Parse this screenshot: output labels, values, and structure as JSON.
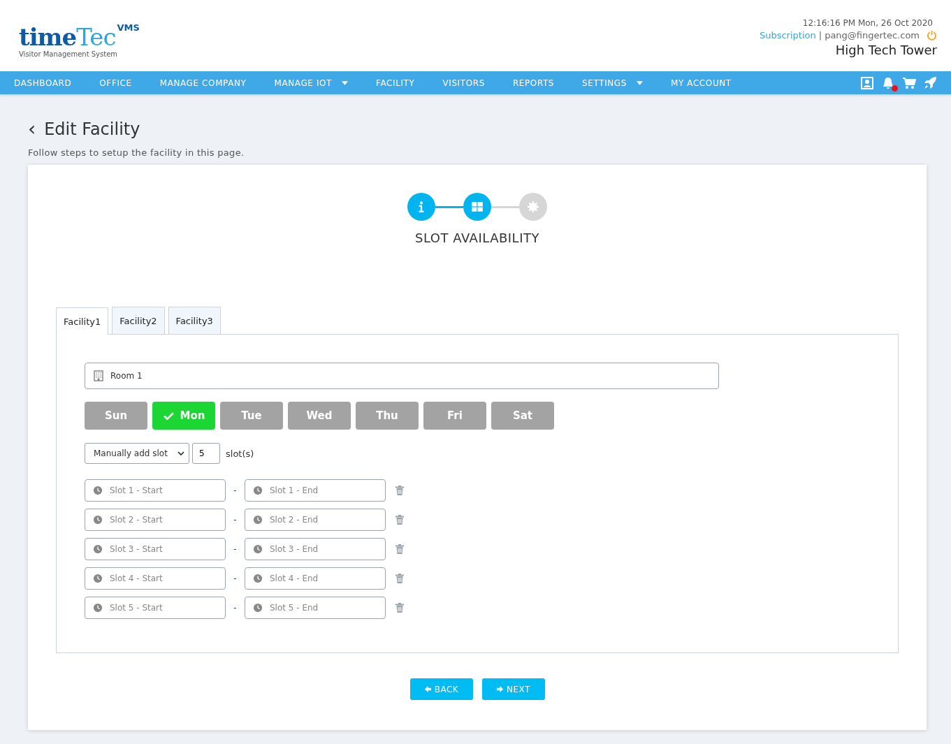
{
  "logo": {
    "word_1": "time",
    "word_2": "Tec",
    "badge": "VMS",
    "tagline": "Visitor Management System"
  },
  "header": {
    "datetime": "12:16:16 PM  Mon, 26 Oct 2020",
    "subscription_link": "Subscription",
    "separator": "|",
    "email": "pang@fingertec.com",
    "site": "High Tech Tower"
  },
  "nav": [
    {
      "label": "DASHBOARD",
      "has_dropdown": false
    },
    {
      "label": "OFFICE",
      "has_dropdown": false
    },
    {
      "label": "MANAGE COMPANY",
      "has_dropdown": false
    },
    {
      "label": "MANAGE IOT",
      "has_dropdown": true
    },
    {
      "label": "FACILITY",
      "has_dropdown": false
    },
    {
      "label": "VISITORS",
      "has_dropdown": false
    },
    {
      "label": "REPORTS",
      "has_dropdown": false
    },
    {
      "label": "SETTINGS",
      "has_dropdown": true
    },
    {
      "label": "MY ACCOUNT",
      "has_dropdown": false
    }
  ],
  "nav_icons": [
    {
      "kind": "contact",
      "badge": false
    },
    {
      "kind": "bell",
      "badge": true
    },
    {
      "kind": "cart",
      "badge": false
    },
    {
      "kind": "rocket",
      "badge": false
    }
  ],
  "page": {
    "back_icon": "‹",
    "title": "Edit Facility",
    "subtitle": "Follow steps to setup the facility in this page."
  },
  "steps": [
    {
      "kind": "info",
      "active": true
    },
    {
      "kind": "grid",
      "active": true
    },
    {
      "kind": "gear",
      "active": false
    }
  ],
  "step_title": "SLOT AVAILABILITY",
  "tabs": [
    {
      "label": "Facility1",
      "selected": true
    },
    {
      "label": "Facility2",
      "selected": false
    },
    {
      "label": "Facility3",
      "selected": false
    }
  ],
  "room_field": {
    "value": "Room 1"
  },
  "days": [
    {
      "label": "Sun",
      "selected": false
    },
    {
      "label": "Mon",
      "selected": true
    },
    {
      "label": "Tue",
      "selected": false
    },
    {
      "label": "Wed",
      "selected": false
    },
    {
      "label": "Thu",
      "selected": false
    },
    {
      "label": "Fri",
      "selected": false
    },
    {
      "label": "Sat",
      "selected": false
    }
  ],
  "slot_mode": {
    "value": "Manually add slot",
    "count": "5",
    "unit": "slot(s)"
  },
  "slots": [
    {
      "start": "Slot 1 - Start",
      "separator": "-",
      "end": "Slot 1 - End"
    },
    {
      "start": "Slot 2 - Start",
      "separator": "-",
      "end": "Slot 2 - End"
    },
    {
      "start": "Slot 3 - Start",
      "separator": "-",
      "end": "Slot 3 - End"
    },
    {
      "start": "Slot 4 - Start",
      "separator": "-",
      "end": "Slot 4 - End"
    },
    {
      "start": "Slot 5 - Start",
      "separator": "-",
      "end": "Slot 5 - End"
    }
  ],
  "buttons": [
    {
      "kind": "back",
      "label": "BACK"
    },
    {
      "kind": "next",
      "label": "NEXT"
    }
  ]
}
